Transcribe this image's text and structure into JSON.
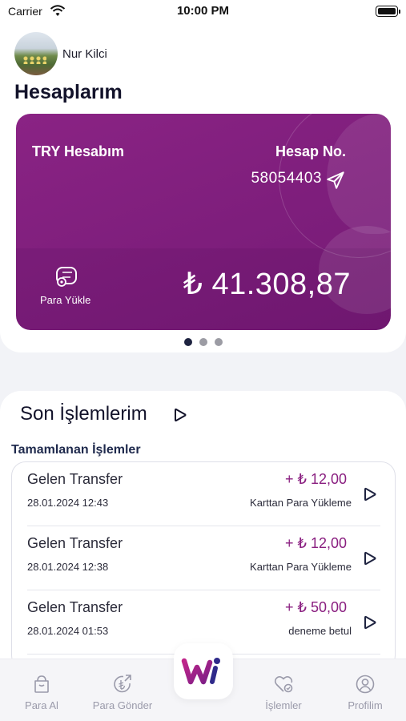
{
  "status_bar": {
    "carrier": "Carrier",
    "time": "10:00 PM"
  },
  "profile": {
    "name": "Nur Kilci"
  },
  "accounts": {
    "title": "Hesaplarım",
    "card": {
      "name": "TRY Hesabım",
      "number_label": "Hesap No.",
      "number": "58054403",
      "load_label": "Para Yükle",
      "balance": "₺ 41.308,87",
      "color": "#8a2384"
    },
    "page_count": 3,
    "active_page": 1
  },
  "transactions": {
    "title": "Son İşlemlerim",
    "subtitle": "Tamamlanan İşlemler",
    "items": [
      {
        "name": "Gelen Transfer",
        "date": "28.01.2024 12:43",
        "amount": "+ ₺ 12,00",
        "desc": "Karttan Para Yükleme"
      },
      {
        "name": "Gelen Transfer",
        "date": "28.01.2024 12:38",
        "amount": "+ ₺ 12,00",
        "desc": "Karttan Para Yükleme"
      },
      {
        "name": "Gelen Transfer",
        "date": "28.01.2024 01:53",
        "amount": "+ ₺ 50,00",
        "desc": "deneme betul"
      }
    ]
  },
  "nav": {
    "items": [
      {
        "label": "Para Al",
        "icon": "wallet-icon"
      },
      {
        "label": "Para Gönder",
        "icon": "send-money-icon"
      },
      {
        "label": "İşlemler",
        "icon": "transactions-icon"
      },
      {
        "label": "Profilim",
        "icon": "user-icon"
      }
    ]
  },
  "colors": {
    "accent": "#8a2384",
    "dark": "#1e2340"
  }
}
